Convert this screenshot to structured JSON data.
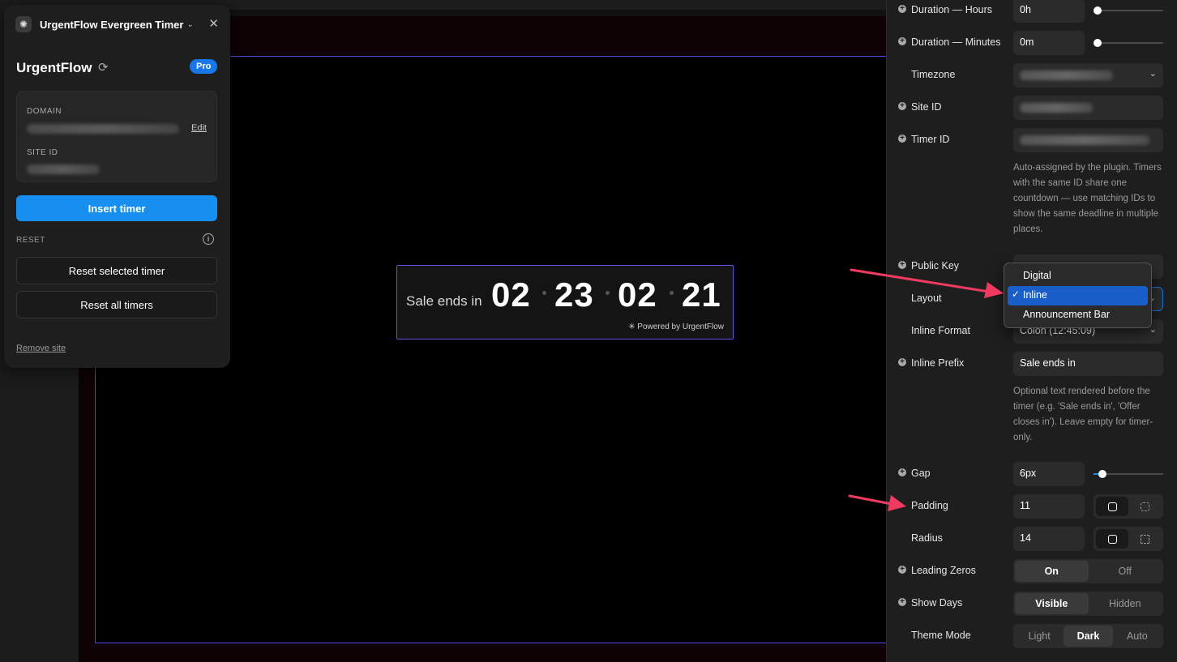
{
  "left_panel": {
    "title": "UrgentFlow Evergreen Timer",
    "brand": "UrgentFlow",
    "badge": "Pro",
    "domain_caption": "DOMAIN",
    "edit_label": "Edit",
    "site_id_caption": "SITE ID",
    "insert_button": "Insert timer",
    "reset_caption": "RESET",
    "reset_selected": "Reset selected timer",
    "reset_all": "Reset all timers",
    "remove_site": "Remove site"
  },
  "timer_widget": {
    "prefix": "Sale ends in",
    "days": "02",
    "hours": "23",
    "minutes": "02",
    "seconds": "21",
    "powered": "Powered by UrgentFlow"
  },
  "settings": {
    "duration_hours_label": "Duration — Hours",
    "duration_hours_value": "0h",
    "duration_minutes_label": "Duration — Minutes",
    "duration_minutes_value": "0m",
    "timezone_label": "Timezone",
    "site_id_label": "Site ID",
    "timer_id_label": "Timer ID",
    "timer_id_help": "Auto-assigned by the plugin. Timers with the same ID share one countdown — use matching IDs to show the same deadline in multiple places.",
    "public_key_label": "Public Key",
    "layout_label": "Layout",
    "inline_format_label": "Inline Format",
    "inline_format_value": "Colon (12:45:09)",
    "inline_prefix_label": "Inline Prefix",
    "inline_prefix_value": "Sale ends in",
    "inline_prefix_help": "Optional text rendered before the timer (e.g. 'Sale ends in', 'Offer closes in'). Leave empty for timer-only.",
    "gap_label": "Gap",
    "gap_value": "6px",
    "padding_label": "Padding",
    "padding_value": "11",
    "radius_label": "Radius",
    "radius_value": "14",
    "leading_zeros_label": "Leading Zeros",
    "leading_zeros_on": "On",
    "leading_zeros_off": "Off",
    "show_days_label": "Show Days",
    "show_days_visible": "Visible",
    "show_days_hidden": "Hidden",
    "theme_mode_label": "Theme Mode",
    "theme_light": "Light",
    "theme_dark": "Dark",
    "theme_auto": "Auto"
  },
  "layout_dropdown": {
    "options": [
      "Digital",
      "Inline",
      "Announcement Bar"
    ],
    "selected": "Inline"
  },
  "colors": {
    "accent": "#168ff0",
    "selection": "#1a5fc9",
    "arrow": "#f03a5f"
  }
}
